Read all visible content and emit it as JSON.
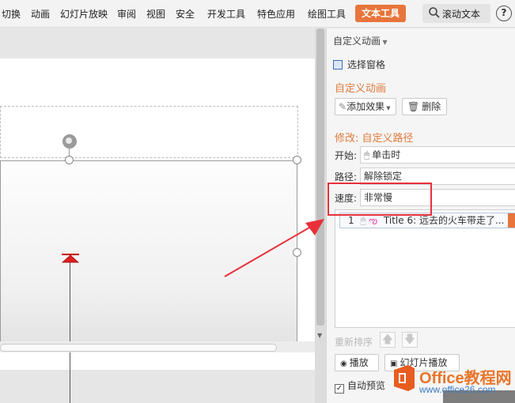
{
  "ribbon": {
    "tabs": [
      "切换",
      "动画",
      "幻灯片放映",
      "审阅",
      "视图",
      "安全",
      "开发工具",
      "特色应用",
      "绘图工具"
    ],
    "active_tab": "文本工具",
    "search_label": "滚动文本",
    "help_label": "?"
  },
  "pane": {
    "header": "自定义动画",
    "selection_pane": "选择窗格",
    "section_title": "自定义动画",
    "add_effect": "添加效果",
    "delete": "删除",
    "modify_title": "修改: 自定义路径",
    "start_label": "开始:",
    "start_value": "单击时",
    "path_label": "路径:",
    "path_value": "解除锁定",
    "speed_label": "速度:",
    "speed_value": "非常慢",
    "animation_item": {
      "index": "1",
      "text": "Title 6: 远去的火车带走了..."
    },
    "reorder_label": "重新排序",
    "play": "播放",
    "slideshow": "幻灯片播放",
    "auto_preview": "自动预览",
    "auto_preview_checked": true
  },
  "watermark": {
    "title": "Office教程网",
    "url": "www.office26.com"
  },
  "colors": {
    "accent": "#e8753b",
    "annotation": "#e8303a",
    "section_title": "#e07a3c"
  }
}
